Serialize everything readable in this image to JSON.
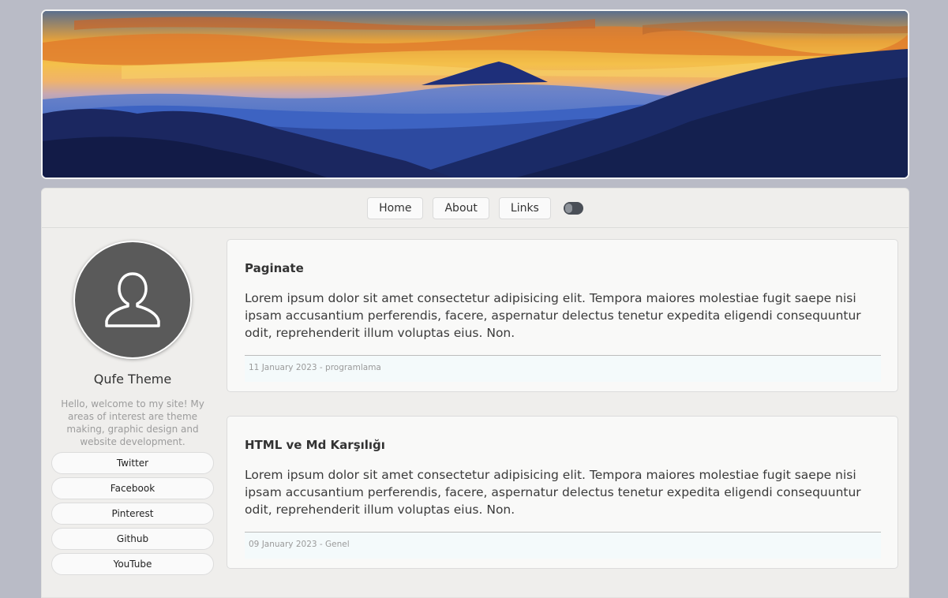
{
  "nav": {
    "home": "Home",
    "about": "About",
    "links": "Links"
  },
  "sidebar": {
    "site_name": "Qufe Theme",
    "description": "Hello, welcome to my site! My areas of interest are theme making, graphic design and website development.",
    "social": [
      "Twitter",
      "Facebook",
      "Pinterest",
      "Github",
      "YouTube"
    ]
  },
  "posts": [
    {
      "title": "Paginate",
      "body": "Lorem ipsum dolor sit amet consectetur adipisicing elit. Tempora maiores molestiae fugit saepe nisi ipsam accusantium perferendis, facere, aspernatur delectus tenetur expedita eligendi consequuntur odit, reprehenderit illum voluptas eius. Non.",
      "meta": "11 January 2023 - programlama"
    },
    {
      "title": "HTML ve Md Karşılığı",
      "body": "Lorem ipsum dolor sit amet consectetur adipisicing elit. Tempora maiores molestiae fugit saepe nisi ipsam accusantium perferendis, facere, aspernatur delectus tenetur expedita eligendi consequuntur odit, reprehenderit illum voluptas eius. Non.",
      "meta": "09 January 2023 - Genel"
    }
  ],
  "icons": {
    "avatar": "user-icon",
    "theme_toggle": "theme-toggle-icon"
  },
  "colors": {
    "page_bg": "#b9bbc6",
    "panel_bg": "#efeeec",
    "card_bg": "#f9f9f8",
    "avatar_bg": "#5a5a5a"
  }
}
